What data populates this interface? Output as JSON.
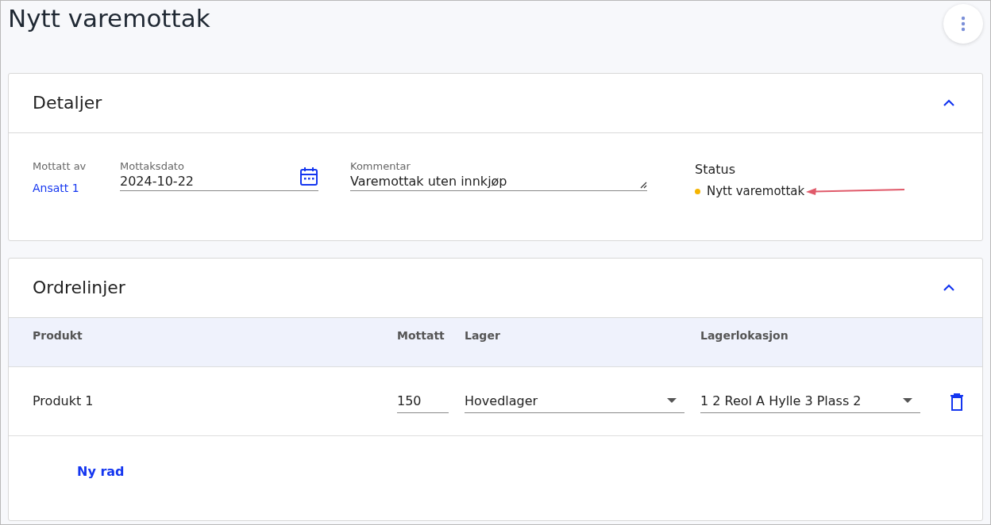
{
  "page": {
    "title": "Nytt varemottak"
  },
  "details": {
    "title": "Detaljer",
    "expanded": true,
    "received_by": {
      "label": "Mottatt av",
      "value": "Ansatt 1"
    },
    "date": {
      "label": "Mottaksdato",
      "value": "2024-10-22"
    },
    "comment": {
      "label": "Kommentar",
      "value": "Varemottak uten innkjøp"
    },
    "status": {
      "label": "Status",
      "value": "Nytt varemottak",
      "color": "#f5b400"
    }
  },
  "order_lines": {
    "title": "Ordrelinjer",
    "expanded": true,
    "columns": [
      "Produkt",
      "Mottatt",
      "Lager",
      "Lagerlokasjon"
    ],
    "rows": [
      {
        "product": "Produkt 1",
        "received": "150",
        "warehouse": "Hovedlager",
        "location": "1 2 Reol A Hylle 3 Plass 2"
      }
    ],
    "add_button": "Ny rad"
  }
}
